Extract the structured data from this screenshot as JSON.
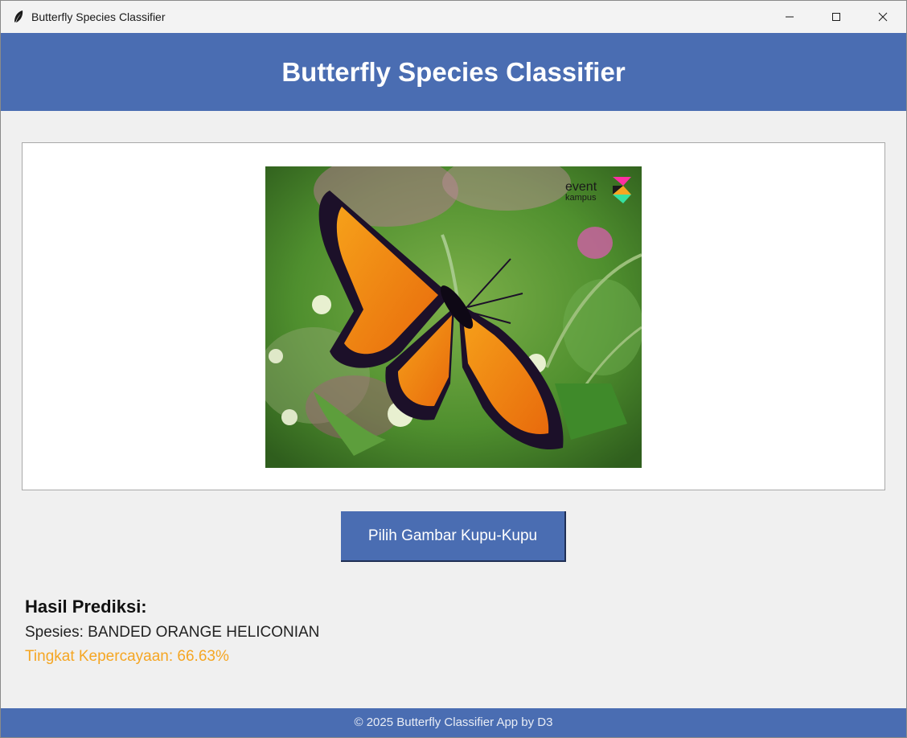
{
  "window": {
    "title": "Butterfly Species Classifier",
    "controls": [
      "minimize-icon",
      "maximize-icon",
      "close-icon"
    ]
  },
  "header": {
    "title": "Butterfly Species Classifier"
  },
  "image_preview": {
    "watermark_line1": "event",
    "watermark_line2": "kampus"
  },
  "actions": {
    "pick_image_label": "Pilih Gambar Kupu-Kupu"
  },
  "result": {
    "heading": "Hasil Prediksi:",
    "species": "Spesies: BANDED ORANGE HELICONIAN",
    "confidence": "Tingkat Kepercayaan: 66.63%"
  },
  "footer": {
    "text": "© 2025 Butterfly Classifier App by D3"
  },
  "colors": {
    "accent": "#4a6db2",
    "confidence": "#f5a623",
    "background": "#f0f0f0"
  }
}
